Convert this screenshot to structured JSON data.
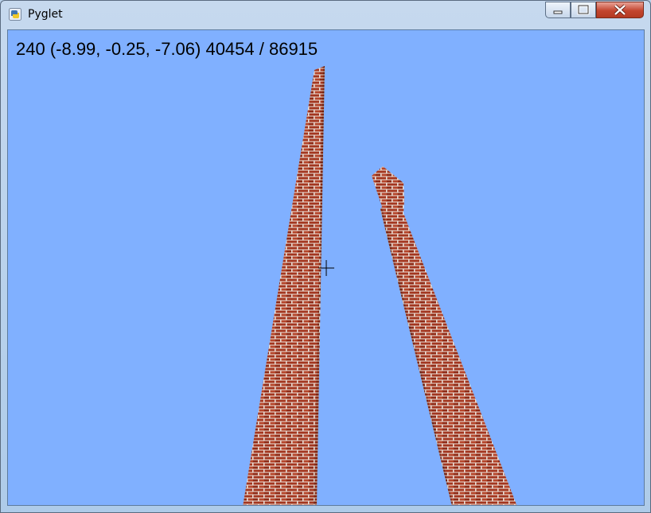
{
  "window": {
    "title": "Pyglet",
    "controls": {
      "minimize": "minimize",
      "maximize": "maximize",
      "close": "close"
    }
  },
  "hud": {
    "stats_text": "240 (-8.99, -0.25, -7.06) 40454 / 86915"
  },
  "scene": {
    "sky_color": "#80b0ff",
    "brick_color": "#a3361f",
    "mortar_color": "#ece4dc",
    "objects": [
      "brick-pillar-left",
      "brick-pillar-right"
    ],
    "crosshair": "crosshair-icon"
  },
  "colors": {
    "titlebar_top": "#c6d9ee",
    "titlebar_bottom": "#aecbe9",
    "close_button": "#c3452f"
  }
}
